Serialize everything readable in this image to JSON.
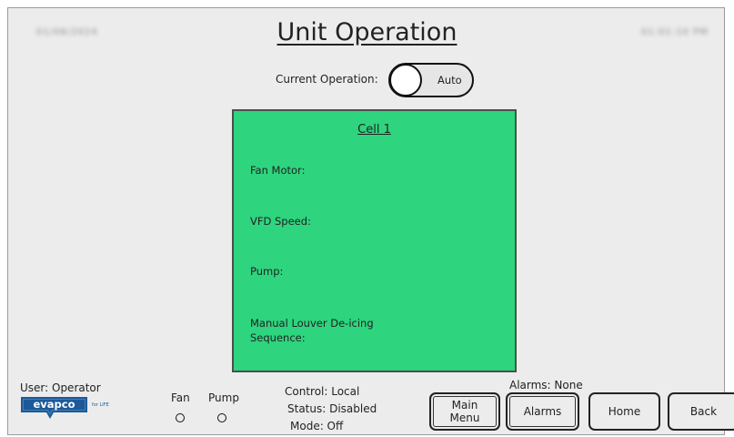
{
  "header": {
    "title": "Unit Operation",
    "date_redacted": "01/06/2024",
    "time_redacted": "01:01:10 PM"
  },
  "operation": {
    "label": "Current Operation:",
    "toggle_value": "Auto"
  },
  "cell": {
    "title": "Cell 1",
    "fields": [
      "Fan Motor:",
      "VFD Speed:",
      "Pump:",
      "Manual Louver De-icing",
      "Sequence:"
    ]
  },
  "footer": {
    "user": "User: Operator",
    "logo_text": "evapco",
    "logo_tagline": "for LIFE",
    "indicators": {
      "fan": "Fan",
      "pump": "Pump"
    },
    "control": "Control: Local",
    "status": "Status: Disabled",
    "mode": "Mode:  Off",
    "alarms": "Alarms:  None"
  },
  "buttons": {
    "main_menu": "Main Menu",
    "alarms": "Alarms",
    "home": "Home",
    "back": "Back"
  },
  "colors": {
    "cell_fill": "#2ed47e",
    "logo_blue": "#1b5a9a"
  }
}
